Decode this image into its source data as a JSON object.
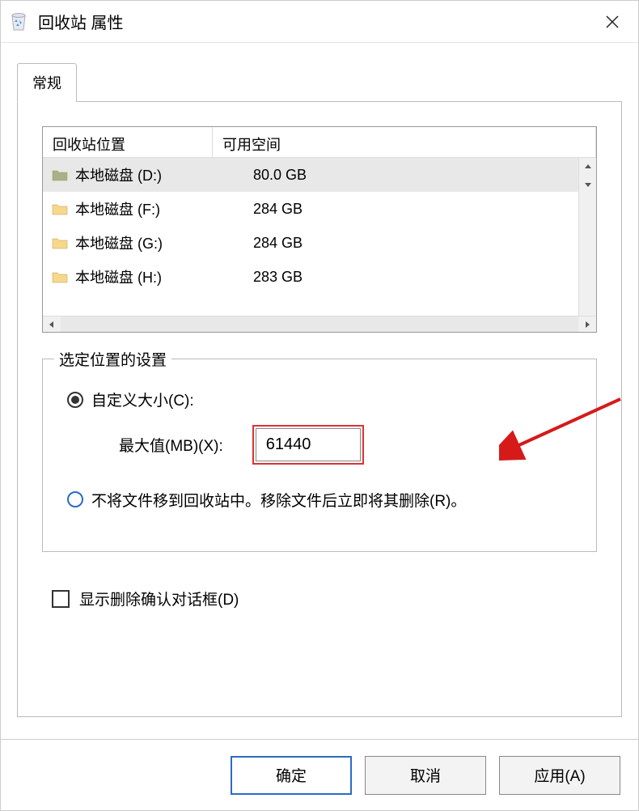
{
  "titlebar": {
    "title": "回收站 属性"
  },
  "tab": {
    "general_label": "常规"
  },
  "listview": {
    "headers": {
      "col1": "回收站位置",
      "col2": "可用空间"
    },
    "rows": [
      {
        "name": "本地磁盘 (D:)",
        "size": "80.0 GB",
        "selected": true,
        "icon_color": "#a8b08c"
      },
      {
        "name": "本地磁盘 (F:)",
        "size": "284 GB",
        "selected": false,
        "icon_color": "#f7d88b"
      },
      {
        "name": "本地磁盘 (G:)",
        "size": "284 GB",
        "selected": false,
        "icon_color": "#f7d88b"
      },
      {
        "name": "本地磁盘 (H:)",
        "size": "283 GB",
        "selected": false,
        "icon_color": "#f7d88b"
      }
    ]
  },
  "groupbox": {
    "title": "选定位置的设置",
    "custom_size_label": "自定义大小(C):",
    "max_label": "最大值(MB)(X):",
    "max_value": "61440",
    "no_move_label": "不将文件移到回收站中。移除文件后立即将其删除(R)。"
  },
  "confirm_checkbox": {
    "label": "显示删除确认对话框(D)"
  },
  "buttons": {
    "ok": "确定",
    "cancel": "取消",
    "apply": "应用(A)"
  }
}
